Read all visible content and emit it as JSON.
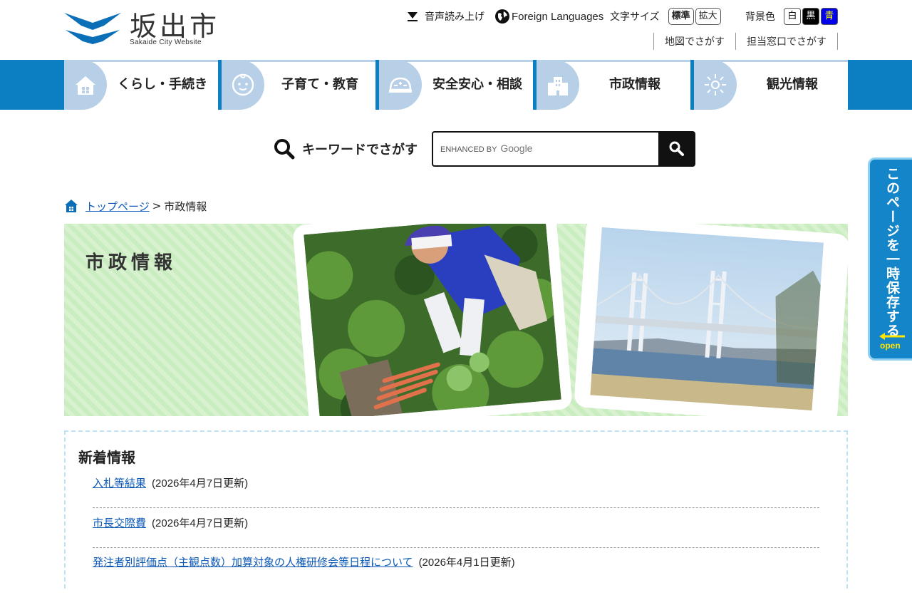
{
  "header": {
    "site_name": "坂出市",
    "site_sub": "Sakaide City Website",
    "audio_label": "音声読み上げ",
    "lang_label": "Foreign Languages",
    "font_size_label": "文字サイズ",
    "font_size_standard": "標準",
    "font_size_large": "拡大",
    "bg_label": "背景色",
    "bg_white": "白",
    "bg_black": "黒",
    "bg_blue": "青",
    "map_search": "地図でさがす",
    "dept_search": "担当窓口でさがす"
  },
  "nav": {
    "items": [
      {
        "label": "くらし・手続き",
        "icon": "house-icon"
      },
      {
        "label": "子育て・教育",
        "icon": "baby-icon"
      },
      {
        "label": "安全安心・相談",
        "icon": "helmet-icon"
      },
      {
        "label": "市政情報",
        "icon": "building-icon"
      },
      {
        "label": "観光情報",
        "icon": "sparkle-icon"
      }
    ]
  },
  "search": {
    "label": "キーワードでさがす",
    "enhanced": "ENHANCED BY",
    "google": "Google"
  },
  "breadcrumb": {
    "home": "トップページ",
    "separator": ">",
    "current": "市政情報"
  },
  "banner": {
    "title": "市政情報"
  },
  "news": {
    "heading": "新着情報",
    "items": [
      {
        "title": "入札等結果",
        "date": "(2026年4月7日更新)"
      },
      {
        "title": "市長交際費",
        "date": "(2026年4月7日更新)"
      },
      {
        "title": "発注者別評価点（主観点数）加算対象の人権研修会等日程について",
        "date": "(2026年4月1日更新)"
      }
    ]
  },
  "side_tab": {
    "text": "このページを一時保存する",
    "open": "open"
  },
  "colors": {
    "nav_bg": "#0b7fc2",
    "nav_icon_bg": "#b8cfe8",
    "banner_green": "#c9ecc0",
    "side_tab": "#1485c9"
  }
}
